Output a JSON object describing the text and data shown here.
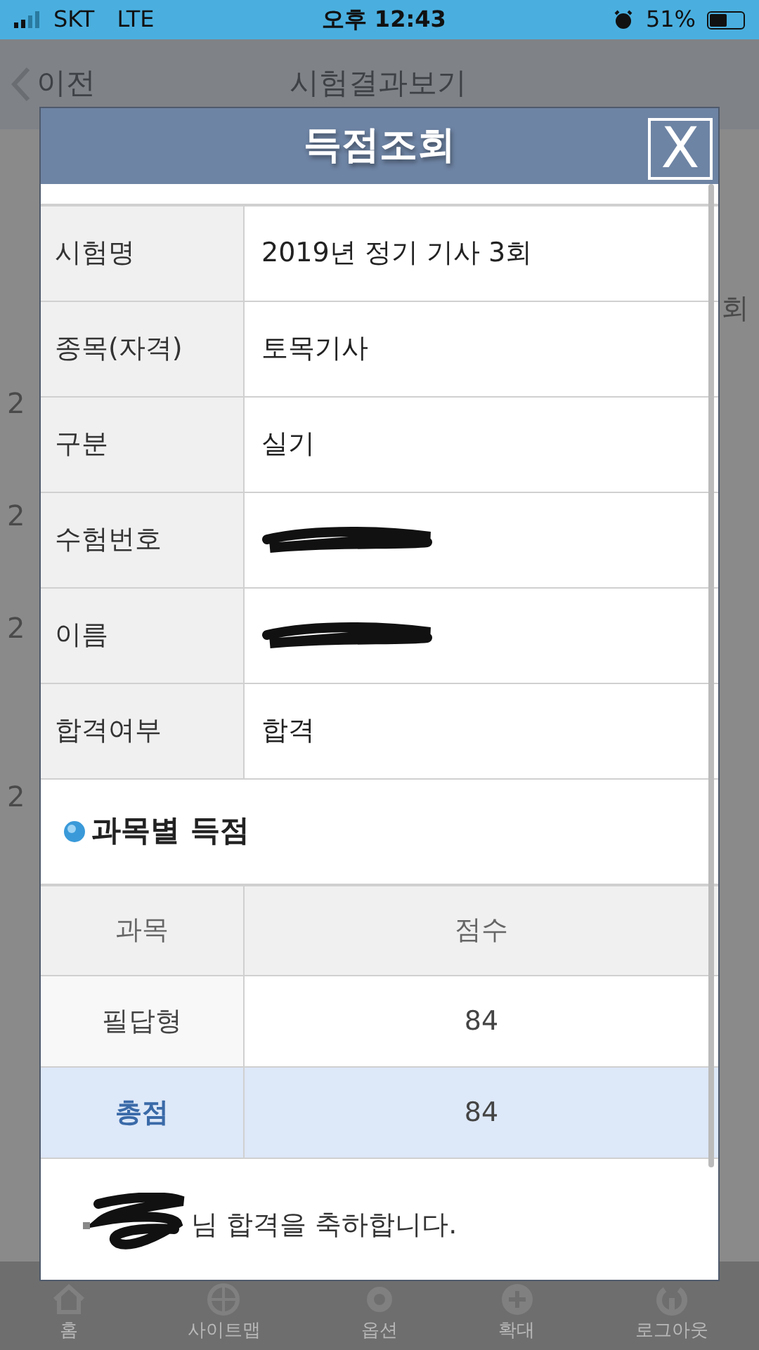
{
  "status_bar": {
    "carrier": "SKT",
    "network": "LTE",
    "time": "오후 12:43",
    "battery": "51%"
  },
  "page": {
    "back": "이전",
    "title": "시험결과보기",
    "left_fragments": [
      "2",
      "2",
      "2",
      "2"
    ],
    "right_fragment": "회"
  },
  "tab_bar": [
    {
      "label": "홈",
      "kind": "home"
    },
    {
      "label": "사이트맵",
      "kind": "globe"
    },
    {
      "label": "옵션",
      "kind": "gear"
    },
    {
      "label": "확대",
      "kind": "plus"
    },
    {
      "label": "로그아웃",
      "kind": "power"
    }
  ],
  "modal": {
    "title": "득점조회",
    "close": "X",
    "exam_rows": [
      {
        "label": "시험명",
        "value": "2019년 정기 기사 3회",
        "redacted": false
      },
      {
        "label": "종목(자격)",
        "value": "토목기사",
        "redacted": false
      },
      {
        "label": "구분",
        "value": "실기",
        "redacted": false
      },
      {
        "label": "수험번호",
        "redacted": true
      },
      {
        "label": "이름",
        "redacted": true
      },
      {
        "label": "합격여부",
        "value": "합격",
        "redacted": false
      }
    ],
    "score_section": "과목별 득점",
    "score_columns": [
      "과목",
      "점수"
    ],
    "score_rows": [
      {
        "subject": "필답형",
        "score": "84",
        "total": false
      },
      {
        "subject": "총점",
        "score": "84",
        "total": true
      }
    ],
    "message": "님 합격을 축하합니다.",
    "message_redacted": true
  }
}
